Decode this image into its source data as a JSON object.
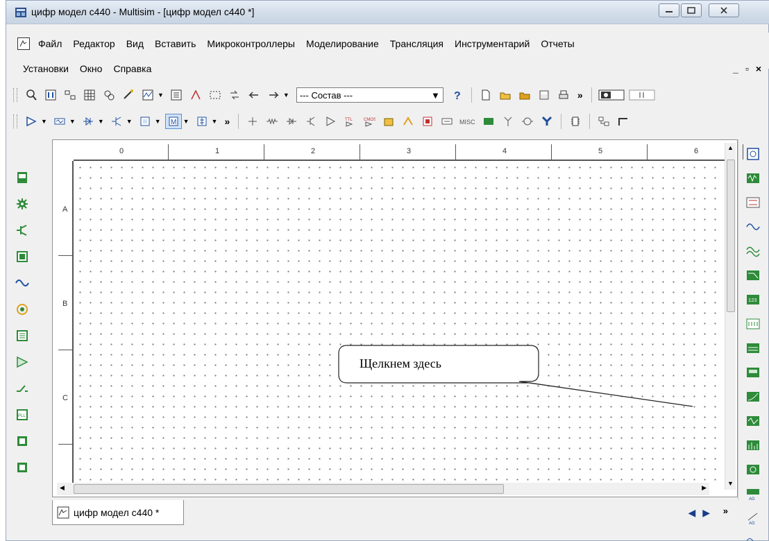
{
  "window": {
    "title": "цифр модел c440 - Multisim - [цифр модел c440 *]"
  },
  "menus": {
    "row1": [
      "Файл",
      "Редактор",
      "Вид",
      "Вставить",
      "Микроконтроллеры",
      "Моделирование",
      "Трансляция",
      "Инструментарий",
      "Отчеты"
    ],
    "row2": [
      "Установки",
      "Окно",
      "Справка"
    ]
  },
  "toolbar": {
    "combo_value": "--- Состав ---"
  },
  "rulers": {
    "top": [
      "0",
      "1",
      "2",
      "3",
      "4",
      "5",
      "6"
    ],
    "left": [
      "A",
      "B",
      "C"
    ]
  },
  "callout": {
    "text": "Щелкнем здесь"
  },
  "tabs": [
    {
      "label": "цифр модел c440 *"
    }
  ],
  "colors": {
    "titlebar": "#d4deea",
    "workspace": "#ffffff",
    "grid_dot": "#777777",
    "palette_green": "#2e8b3a",
    "palette_blue": "#1f4fa0"
  }
}
